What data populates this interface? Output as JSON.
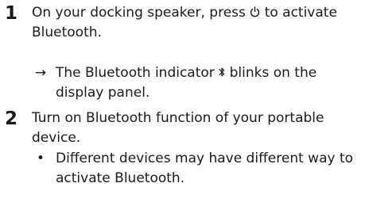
{
  "steps": [
    {
      "number": "1",
      "text_before": "On your docking speaker, press",
      "icon": "power-icon",
      "text_after": "to activate Bluetooth.",
      "sub": {
        "marker": "→",
        "text_before": "The Bluetooth indicator",
        "icon": "bluetooth-icon",
        "text_after": "blinks on the display panel."
      }
    },
    {
      "number": "2",
      "text": "Turn on Bluetooth function of your portable device.",
      "sub": {
        "marker": "•",
        "text": "Different devices may have different way to activate Bluetooth."
      }
    }
  ]
}
